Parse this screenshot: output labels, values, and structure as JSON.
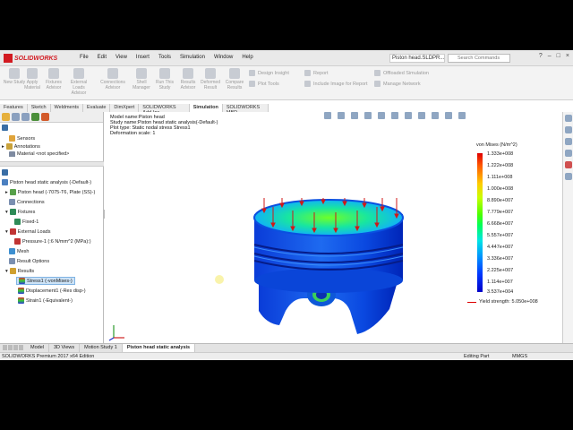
{
  "app": {
    "logo_text": "SOLIDWORKS",
    "menu": [
      "File",
      "Edit",
      "View",
      "Insert",
      "Tools",
      "Simulation",
      "Window",
      "Help"
    ],
    "document_name": "Piston head.SLDPR...",
    "search_placeholder": "Search Commands",
    "window_buttons": [
      "?",
      "–",
      "□",
      "×"
    ]
  },
  "ribbon": {
    "big_buttons": [
      "New Study",
      "Apply Material",
      "Fixtures Advisor",
      "External Loads Advisor",
      "Connections Advisor",
      "Shell Manager",
      "Run This Study",
      "Results Advisor",
      "Deformed Result",
      "Compare Results"
    ],
    "col1": [
      "Design Insight",
      "Plot Tools"
    ],
    "col2": [
      "Report",
      "Include Image for Report"
    ],
    "col3": [
      "Offloaded Simulation",
      "Manage Network"
    ]
  },
  "command_tabs": [
    "Features",
    "Sketch",
    "Weldments",
    "Evaluate",
    "DimXpert",
    "SOLIDWORKS Add-Ins",
    "Simulation",
    "SOLIDWORKS MBD"
  ],
  "active_command_tab": "Simulation",
  "feature_tree": {
    "items": [
      "Sensors",
      "Annotations",
      "Material <not specified>"
    ]
  },
  "study_tree": {
    "study": "Piston head static analysis (-Default-)",
    "part": "Piston head (-7075-T6, Plate (SS)-)",
    "connections": "Connections",
    "fixtures": "Fixtures",
    "fixed": "Fixed-1",
    "external_loads": "External Loads",
    "pressure": "Pressure-1 (:6 N/mm^2 (MPa):)",
    "mesh": "Mesh",
    "result_options": "Result Options",
    "results": "Results",
    "stress": "Stress1 (-vonMises-)",
    "displacement": "Displacement1 (-Res disp-)",
    "strain": "Strain1 (-Equivalent-)"
  },
  "viewport": {
    "model_name": "Model name:Piston head",
    "study_name": "Study name:Piston head static analysis(-Default-)",
    "plot_type": "Plot type: Static nodal stress Stress1",
    "deformation_scale": "Deformation scale: 1"
  },
  "legend": {
    "title": "von Mises (N/m^2)",
    "values": [
      "1.333e+008",
      "1.222e+008",
      "1.111e+008",
      "1.000e+008",
      "8.890e+007",
      "7.779e+007",
      "6.668e+007",
      "5.557e+007",
      "4.447e+007",
      "3.336e+007",
      "2.225e+007",
      "1.114e+007",
      "3.537e+004"
    ],
    "yield_strength": "Yield strength: 5.050e+008"
  },
  "bottom_tabs": [
    "Model",
    "3D Views",
    "Motion Study 1",
    "Piston head static analysis"
  ],
  "active_bottom_tab": "Piston head static analysis",
  "status": {
    "edition": "SOLIDWORKS Premium 2017 x64 Edition",
    "mode": "Editing Part",
    "units": "MMGS"
  }
}
